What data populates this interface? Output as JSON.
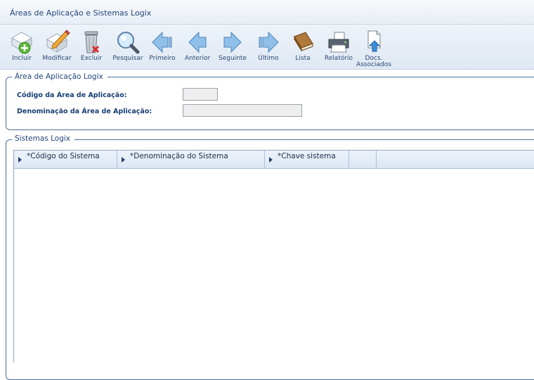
{
  "window": {
    "title": "Áreas de Aplicação e Sistemas Logix"
  },
  "toolbar": {
    "buttons": [
      {
        "label": "Incluir",
        "icon": "add-icon"
      },
      {
        "label": "Modificar",
        "icon": "edit-icon"
      },
      {
        "label": "Excluir",
        "icon": "trash-icon"
      },
      {
        "label": "Pesquisar",
        "icon": "search-icon"
      },
      {
        "label": "Primeiro",
        "icon": "first-arrow-icon"
      },
      {
        "label": "Anterior",
        "icon": "previous-arrow-icon"
      },
      {
        "label": "Seguinte",
        "icon": "next-arrow-icon"
      },
      {
        "label": "Último",
        "icon": "last-arrow-icon"
      },
      {
        "label": "Lista",
        "icon": "book-icon"
      },
      {
        "label": "Relatório",
        "icon": "printer-icon"
      },
      {
        "label_line1": "Docs.",
        "label_line2": "Associados",
        "icon": "document-upload-icon"
      }
    ]
  },
  "area_section": {
    "legend": "Área de Aplicação Logix",
    "fields": [
      {
        "label": "Código da Área de Aplicação:",
        "value": ""
      },
      {
        "label": "Denominação da Área de Aplicação:",
        "value": ""
      }
    ]
  },
  "sistemas_section": {
    "legend": "Sistemas Logix",
    "columns": [
      {
        "label": "*Código do Sistema"
      },
      {
        "label": "*Denominação do Sistema"
      },
      {
        "label": "*Chave sistema"
      }
    ],
    "rows": []
  },
  "colors": {
    "accent": "#2b5c9a",
    "border": "#4a6f9a",
    "label": "#173f73"
  }
}
